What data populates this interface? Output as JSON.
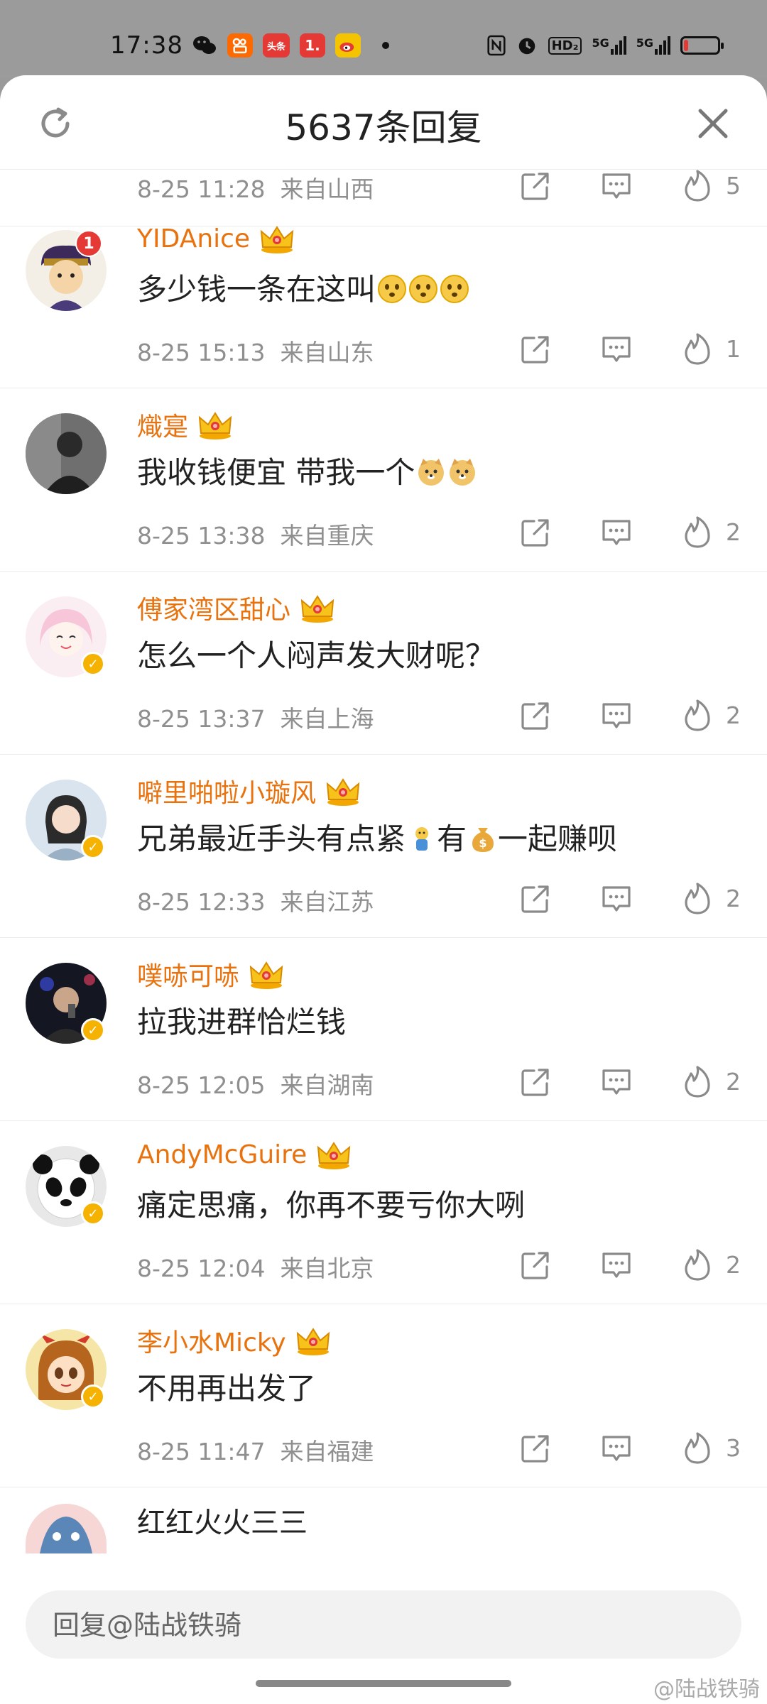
{
  "status_bar": {
    "time": "17:38",
    "app_icons": [
      "wechat-icon",
      "kuaishou-icon",
      "toutiao-icon",
      "app-1-icon",
      "weibo-icon"
    ],
    "toutiao_label": "头条",
    "app1_label": "1.",
    "network_labels": [
      "HD₂",
      "5G",
      "5G"
    ],
    "battery_level": 0.12
  },
  "header": {
    "title": "5637条回复",
    "refresh_icon": "refresh-icon",
    "close_icon": "close-icon"
  },
  "first_meta": {
    "time": "8-25 11:28",
    "location": "来自山西",
    "likes": "5"
  },
  "comments": [
    {
      "name": "YIDAnice",
      "text": "多少钱一条在这叫",
      "emojis": 3,
      "time": "8-25 15:13",
      "location": "来自山东",
      "likes": "1",
      "verified": false,
      "badge": "1"
    },
    {
      "name": "熾寔",
      "text": "我收钱便宜 带我一个",
      "emojis": 2,
      "time": "8-25 13:38",
      "location": "来自重庆",
      "likes": "2",
      "verified": false
    },
    {
      "name": "傅家湾区甜心",
      "text": "怎么一个人闷声发大财呢？",
      "emojis": 0,
      "time": "8-25 13:37",
      "location": "来自上海",
      "likes": "2",
      "verified": true
    },
    {
      "name": "噼里啪啦小璇风",
      "text": "兄弟最近手头有点紧",
      "text2": "有",
      "text3": "一起赚呗",
      "time": "8-25 12:33",
      "location": "来自江苏",
      "likes": "2",
      "verified": true
    },
    {
      "name": "噗哧可哧",
      "text": "拉我进群恰烂钱",
      "emojis": 0,
      "time": "8-25 12:05",
      "location": "来自湖南",
      "likes": "2",
      "verified": true
    },
    {
      "name": "AndyMcGuire",
      "text": "痛定思痛，你再不要亏你大咧",
      "emojis": 0,
      "time": "8-25 12:04",
      "location": "来自北京",
      "likes": "2",
      "verified": true
    },
    {
      "name": "李小水Micky",
      "text": "不用再出发了",
      "emojis": 0,
      "time": "8-25 11:47",
      "location": "来自福建",
      "likes": "3",
      "verified": true
    }
  ],
  "partial_comment": {
    "text": "红红火火三三"
  },
  "reply_input": {
    "placeholder": "回复@陆战铁骑"
  },
  "watermark": "@陆战铁骑",
  "colors": {
    "username": "#e8730e",
    "meta": "#8f8f8f",
    "verified": "#f6b200"
  }
}
